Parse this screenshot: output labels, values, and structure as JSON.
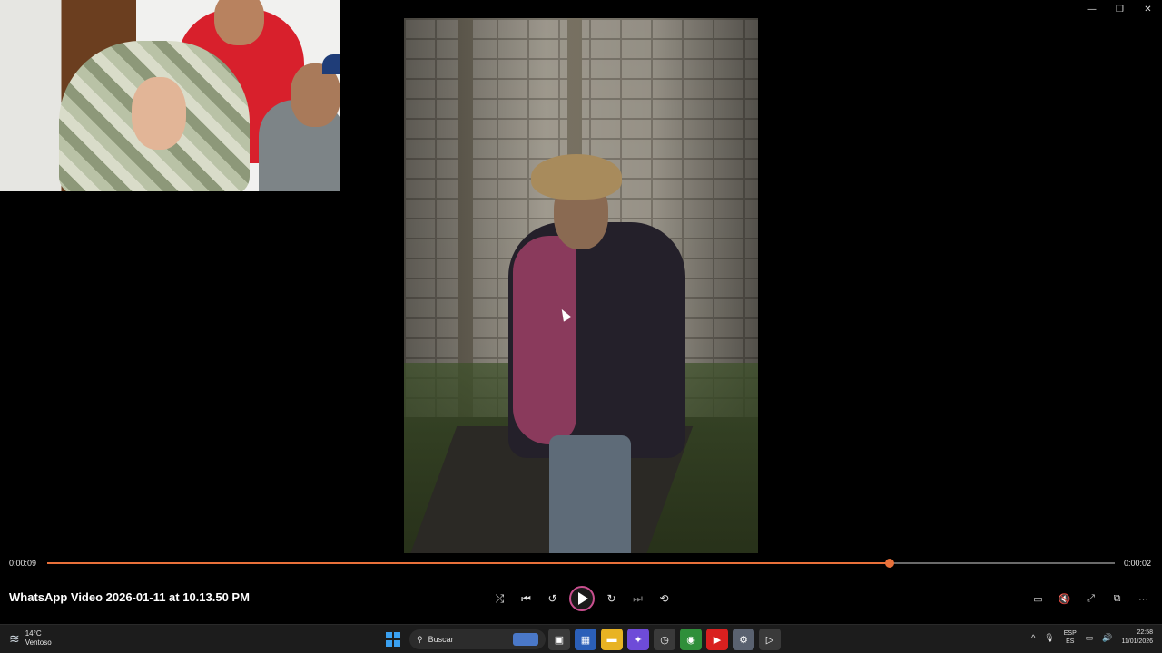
{
  "window": {
    "controls": {
      "minimize": "—",
      "restore": "❐",
      "close": "✕"
    }
  },
  "video": {
    "title": "WhatsApp Video 2026-01-11 at 10.13.50 PM",
    "elapsed": "0:00:09",
    "remaining": "0:00:02",
    "progress_fraction": 0.789
  },
  "controls": {
    "shuffle": "⤮",
    "previous": "⏮",
    "rewind": "↺",
    "forward": "↻",
    "next": "⏭",
    "repeat": "⟲"
  },
  "right_controls": {
    "subtitles": "▭",
    "volume": "🔇",
    "fullscreen": "⤢",
    "miniplayer": "⧉",
    "more": "⋯"
  },
  "taskbar": {
    "weather_temp": "14°C",
    "weather_desc": "Ventoso",
    "search_placeholder": "Buscar",
    "lang_primary": "ESP",
    "lang_secondary": "ES",
    "time": "22:58",
    "date": "11/01/2026",
    "apps": [
      {
        "name": "task-view",
        "color": "#3a3a3a",
        "glyph": "▣"
      },
      {
        "name": "store",
        "color": "#2b5fb8",
        "glyph": "▦"
      },
      {
        "name": "file-explorer",
        "color": "#e8b323",
        "glyph": "▬"
      },
      {
        "name": "copilot",
        "color": "#6e4bd8",
        "glyph": "✦"
      },
      {
        "name": "clock-app",
        "color": "#3a3a3a",
        "glyph": "◷"
      },
      {
        "name": "chrome",
        "color": "#2f8f3a",
        "glyph": "◉"
      },
      {
        "name": "youtube",
        "color": "#d9201f",
        "glyph": "▶"
      },
      {
        "name": "settings",
        "color": "#5a6270",
        "glyph": "⚙"
      },
      {
        "name": "media-player",
        "color": "#3a3a3a",
        "glyph": "▷"
      }
    ],
    "tray_icons": {
      "chevron": "^",
      "mic": "🎙",
      "network": "▭",
      "speaker": "🔊"
    }
  }
}
